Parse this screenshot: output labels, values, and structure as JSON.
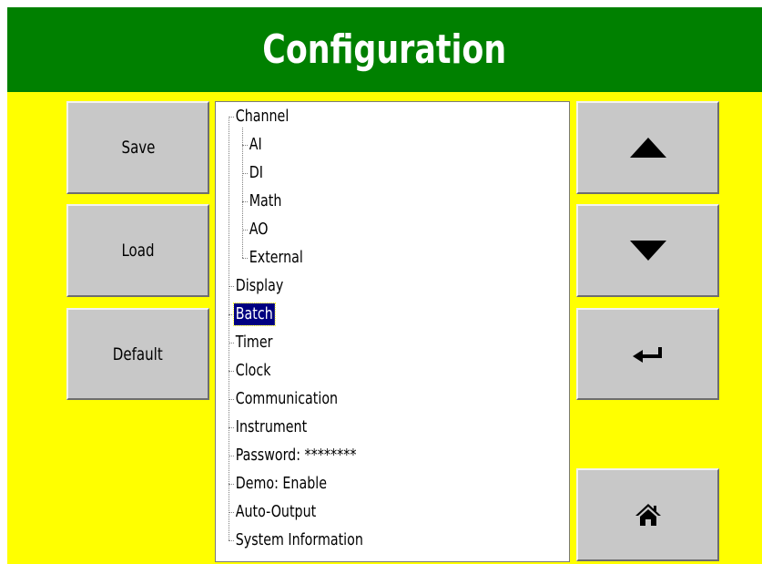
{
  "header": {
    "title": "Configuration"
  },
  "left_buttons": [
    {
      "label": "Save"
    },
    {
      "label": "Load"
    },
    {
      "label": "Default"
    }
  ],
  "right_buttons": {
    "up_icon": "triangle-up-icon",
    "down_icon": "triangle-down-icon",
    "enter_icon": "enter-arrow-icon",
    "home_icon": "home-icon"
  },
  "tree": {
    "items": [
      {
        "label": "Channel",
        "level": 0
      },
      {
        "label": "AI",
        "level": 1
      },
      {
        "label": "DI",
        "level": 1
      },
      {
        "label": "Math",
        "level": 1
      },
      {
        "label": "AO",
        "level": 1
      },
      {
        "label": "External",
        "level": 1
      },
      {
        "label": "Display",
        "level": 0
      },
      {
        "label": "Batch",
        "level": 0,
        "selected": true
      },
      {
        "label": "Timer",
        "level": 0
      },
      {
        "label": "Clock",
        "level": 0
      },
      {
        "label": "Communication",
        "level": 0
      },
      {
        "label": "Instrument",
        "level": 0
      },
      {
        "label": "Password: ********",
        "level": 0
      },
      {
        "label": "Demo: Enable",
        "level": 0
      },
      {
        "label": "Auto-Output",
        "level": 0
      },
      {
        "label": "System Information",
        "level": 0
      }
    ]
  },
  "colors": {
    "header": "#008000",
    "background": "#ffff00",
    "button": "#c8c8c8",
    "selection": "#000080"
  }
}
